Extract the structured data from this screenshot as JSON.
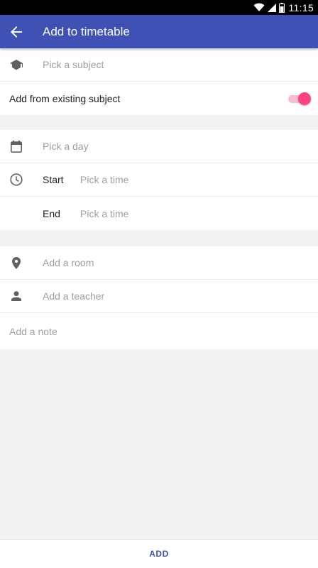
{
  "status_bar": {
    "time": "11:15",
    "icons": [
      "wifi-icon",
      "signal-icon",
      "battery-icon"
    ]
  },
  "app_bar": {
    "title": "Add to timetable",
    "back_icon": "arrow-back-icon",
    "color": "#3f51b5"
  },
  "subject_section": {
    "subject_placeholder": "Pick a subject",
    "subject_icon": "school-icon",
    "existing_label": "Add from existing subject",
    "existing_toggle_on": true,
    "toggle_color": "#ff4081"
  },
  "time_section": {
    "day_placeholder": "Pick a day",
    "day_icon": "calendar-icon",
    "start_label": "Start",
    "start_placeholder": "Pick a time",
    "clock_icon": "clock-icon",
    "end_label": "End",
    "end_placeholder": "Pick a time"
  },
  "details_section": {
    "room_placeholder": "Add a room",
    "room_icon": "location-pin-icon",
    "teacher_placeholder": "Add a teacher",
    "teacher_icon": "person-icon",
    "note_placeholder": "Add a note"
  },
  "footer": {
    "add_label": "ADD"
  }
}
